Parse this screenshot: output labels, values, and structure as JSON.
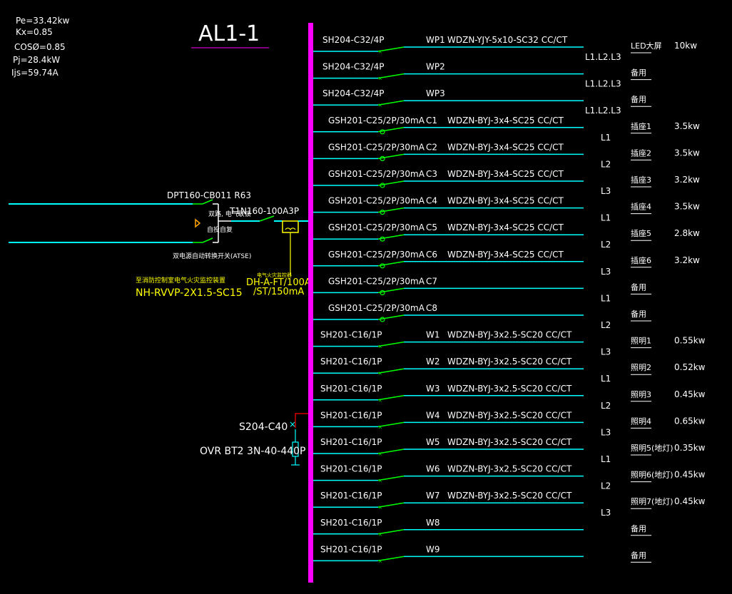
{
  "colors": {
    "background": "#000000",
    "busbar": "#ff00ff",
    "feeder_line": "#00ffff",
    "breaker": "#00ff00",
    "text": "#ffffff",
    "annotation": "#ffff00",
    "surge_wire": "#ff0000",
    "title_underline": "#ff00ff"
  },
  "summary": {
    "lines": [
      "Pe=33.42kw",
      "Kx=0.85",
      "COSØ=0.85",
      "Pj=28.4kW",
      "Ijs=59.74A"
    ]
  },
  "title": "AL1-1",
  "incoming": {
    "atse_model": "DPT160-CB011 R63",
    "atse_side_text_1": "双路, 电气联锁",
    "atse_side_text_2": "自投自复",
    "atse_caption": "双电源自动转换开关(ATSE)",
    "fire_note": "至消防控制室电气火灾监控装置",
    "fire_cable": "NH-RVVP-2X1.5-SC15",
    "main_breaker": "T1N160-100A3P",
    "monitor_note": "电气火灾监控器",
    "monitor_model_1": "DH-A-FT/100A",
    "monitor_model_2": "/ST/150mA"
  },
  "surge": {
    "breaker": "S204-C40",
    "spd": "OVR BT2 3N-40-440P"
  },
  "circuits": [
    {
      "breaker": "SH204-C32/4P",
      "id": "WP1",
      "cable": "WDZN-YJY-5x10-SC32 CC/CT",
      "phase": "L1.L2.L3",
      "load": "LED大屏",
      "power": "10kw"
    },
    {
      "breaker": "SH204-C32/4P",
      "id": "WP2",
      "cable": "",
      "phase": "L1.L2.L3",
      "load": "备用",
      "power": ""
    },
    {
      "breaker": "SH204-C32/4P",
      "id": "WP3",
      "cable": "",
      "phase": "L1.L2.L3",
      "load": "备用",
      "power": ""
    },
    {
      "breaker": "GSH201-C25/2P/30mA",
      "id": "C1",
      "cable": "WDZN-BYJ-3x4-SC25 CC/CT",
      "phase": "L1",
      "load": "插座1",
      "power": "3.5kw"
    },
    {
      "breaker": "GSH201-C25/2P/30mA",
      "id": "C2",
      "cable": "WDZN-BYJ-3x4-SC25 CC/CT",
      "phase": "L2",
      "load": "插座2",
      "power": "3.5kw"
    },
    {
      "breaker": "GSH201-C25/2P/30mA",
      "id": "C3",
      "cable": "WDZN-BYJ-3x4-SC25 CC/CT",
      "phase": "L3",
      "load": "插座3",
      "power": "3.2kw"
    },
    {
      "breaker": "GSH201-C25/2P/30mA",
      "id": "C4",
      "cable": "WDZN-BYJ-3x4-SC25 CC/CT",
      "phase": "L1",
      "load": "插座4",
      "power": "3.5kw"
    },
    {
      "breaker": "GSH201-C25/2P/30mA",
      "id": "C5",
      "cable": "WDZN-BYJ-3x4-SC25 CC/CT",
      "phase": "L2",
      "load": "插座5",
      "power": "2.8kw"
    },
    {
      "breaker": "GSH201-C25/2P/30mA",
      "id": "C6",
      "cable": "WDZN-BYJ-3x4-SC25 CC/CT",
      "phase": "L3",
      "load": "插座6",
      "power": "3.2kw"
    },
    {
      "breaker": "GSH201-C25/2P/30mA",
      "id": "C7",
      "cable": "",
      "phase": "L1",
      "load": "备用",
      "power": ""
    },
    {
      "breaker": "GSH201-C25/2P/30mA",
      "id": "C8",
      "cable": "",
      "phase": "L2",
      "load": "备用",
      "power": ""
    },
    {
      "breaker": "SH201-C16/1P",
      "id": "W1",
      "cable": "WDZN-BYJ-3x2.5-SC20 CC/CT",
      "phase": "L3",
      "load": "照明1",
      "power": "0.55kw"
    },
    {
      "breaker": "SH201-C16/1P",
      "id": "W2",
      "cable": "WDZN-BYJ-3x2.5-SC20 CC/CT",
      "phase": "L1",
      "load": "照明2",
      "power": "0.52kw"
    },
    {
      "breaker": "SH201-C16/1P",
      "id": "W3",
      "cable": "WDZN-BYJ-3x2.5-SC20 CC/CT",
      "phase": "L2",
      "load": "照明3",
      "power": "0.45kw"
    },
    {
      "breaker": "SH201-C16/1P",
      "id": "W4",
      "cable": "WDZN-BYJ-3x2.5-SC20 CC/CT",
      "phase": "L3",
      "load": "照明4",
      "power": "0.65kw"
    },
    {
      "breaker": "SH201-C16/1P",
      "id": "W5",
      "cable": "WDZN-BYJ-3x2.5-SC20 CC/CT",
      "phase": "L1",
      "load": "照明5(地灯)",
      "power": "0.35kw"
    },
    {
      "breaker": "SH201-C16/1P",
      "id": "W6",
      "cable": "WDZN-BYJ-3x2.5-SC20 CC/CT",
      "phase": "L2",
      "load": "照明6(地灯)",
      "power": "0.45kw"
    },
    {
      "breaker": "SH201-C16/1P",
      "id": "W7",
      "cable": "WDZN-BYJ-3x2.5-SC20 CC/CT",
      "phase": "L3",
      "load": "照明7(地灯)",
      "power": "0.45kw"
    },
    {
      "breaker": "SH201-C16/1P",
      "id": "W8",
      "cable": "",
      "phase": "",
      "load": "备用",
      "power": ""
    },
    {
      "breaker": "SH201-C16/1P",
      "id": "W9",
      "cable": "",
      "phase": "",
      "load": "备用",
      "power": ""
    }
  ]
}
